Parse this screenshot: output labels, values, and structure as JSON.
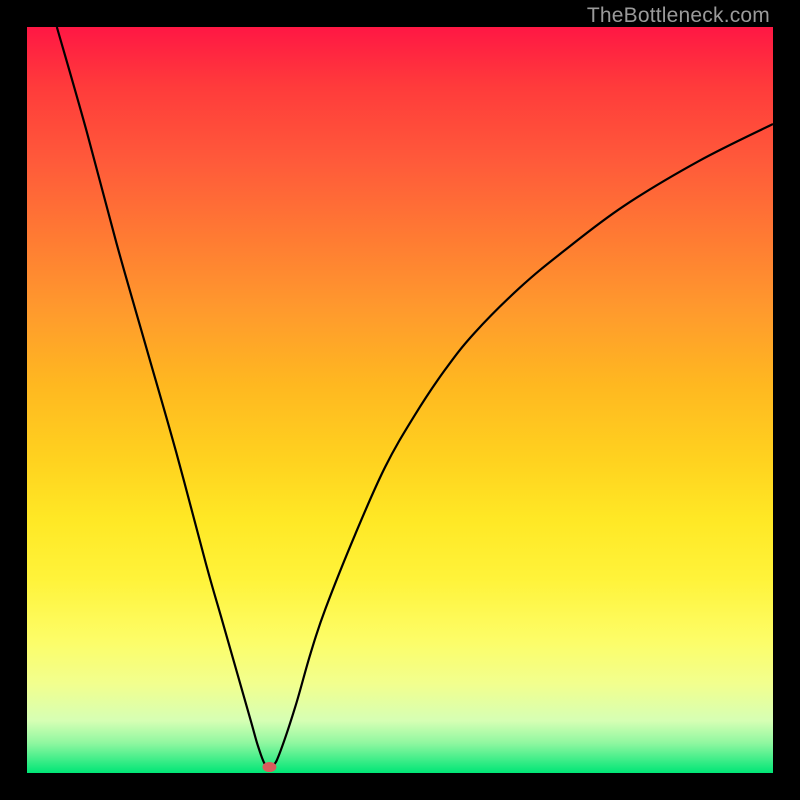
{
  "attribution": "TheBottleneck.com",
  "chart_data": {
    "type": "line",
    "title": "",
    "xlabel": "",
    "ylabel": "",
    "xlim": [
      0,
      100
    ],
    "ylim": [
      0,
      100
    ],
    "series": [
      {
        "name": "curve",
        "x": [
          4,
          8,
          12,
          16,
          20,
          24,
          26,
          28,
          30,
          31,
          32,
          33,
          34,
          36,
          38,
          40,
          44,
          48,
          52,
          56,
          60,
          66,
          72,
          80,
          90,
          100
        ],
        "y": [
          100,
          86,
          71,
          57,
          43,
          28,
          21,
          14,
          7,
          3.5,
          1,
          1,
          3,
          9,
          16,
          22,
          32,
          41,
          48,
          54,
          59,
          65,
          70,
          76,
          82,
          87
        ]
      }
    ],
    "marker": {
      "x": 32.5,
      "y": 0.8
    },
    "background": {
      "gradient": "vertical",
      "stops": [
        {
          "pos": 0,
          "color": "#ff1744"
        },
        {
          "pos": 50,
          "color": "#ffcc20"
        },
        {
          "pos": 100,
          "color": "#00e676"
        }
      ]
    }
  }
}
